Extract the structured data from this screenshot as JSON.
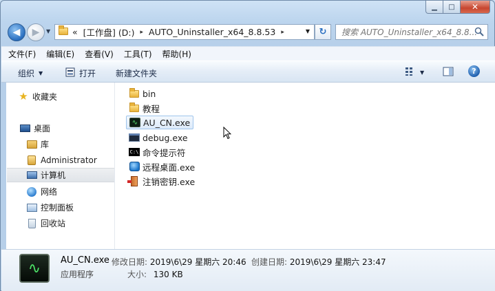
{
  "window": {
    "caption": {
      "minimize": "▁",
      "maximize": "□",
      "close": "✕"
    }
  },
  "nav": {
    "back": "◀",
    "forward": "▶",
    "recent": "▼",
    "address": {
      "overflow": "«",
      "crumbs": [
        "[工作盘] (D:)",
        "AUTO_Uninstaller_x64_8.8.53"
      ],
      "separator": "▸",
      "dropdown": "▼"
    },
    "refresh": "↻",
    "search": {
      "placeholder": "搜索 AUTO_Uninstaller_x64_8.8..."
    }
  },
  "menubar": {
    "items": [
      "文件(F)",
      "编辑(E)",
      "查看(V)",
      "工具(T)",
      "帮助(H)"
    ]
  },
  "commandbar": {
    "organize": "组织",
    "open": "打开",
    "new_folder": "新建文件夹",
    "dropdown": "▼",
    "help": "?"
  },
  "navpane": {
    "favorites": "收藏夹",
    "desktop": "桌面",
    "libraries": "库",
    "user": "Administrator",
    "computer": "计算机",
    "network": "网络",
    "control_panel": "控制面板",
    "recycle_bin": "回收站"
  },
  "files": [
    {
      "name": "bin",
      "icon": "folder-icon"
    },
    {
      "name": "教程",
      "icon": "folder-icon"
    },
    {
      "name": "AU_CN.exe",
      "icon": "activity-monitor-icon",
      "selected": true
    },
    {
      "name": "debug.exe",
      "icon": "console-app-icon"
    },
    {
      "name": "命令提示符",
      "icon": "command-prompt-icon"
    },
    {
      "name": "远程桌面.exe",
      "icon": "remote-desktop-icon"
    },
    {
      "name": "注销密钥.exe",
      "icon": "logoff-door-icon"
    }
  ],
  "details": {
    "name": "AU_CN.exe",
    "type": "应用程序",
    "modified_label": "修改日期:",
    "modified_value": "2019\\6\\29 星期六 20:46",
    "created_label": "创建日期:",
    "created_value": "2019\\6\\29 星期六 23:47",
    "size_label": "大小:",
    "size_value": "130 KB"
  },
  "colors": {
    "frame": "#bcd5ee",
    "selection": "#dceafa",
    "close_button": "#c7462f"
  }
}
